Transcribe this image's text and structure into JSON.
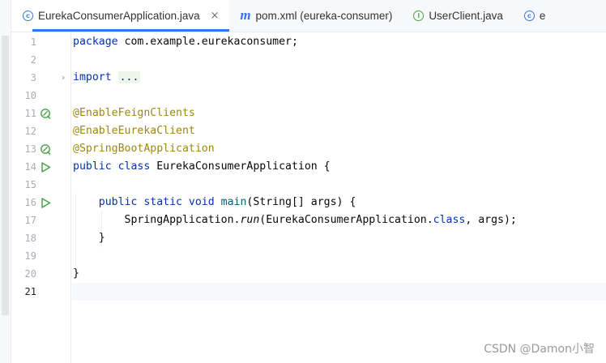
{
  "tabs": [
    {
      "label": "EurekaConsumerApplication.java",
      "icon": "class-icon",
      "glyph": "c",
      "active": true,
      "close": "×"
    },
    {
      "label": "pom.xml (eureka-consumer)",
      "icon": "maven-icon",
      "glyph": "m",
      "active": false
    },
    {
      "label": "UserClient.java",
      "icon": "interface-icon",
      "glyph": "I",
      "active": false
    },
    {
      "label": "e",
      "icon": "class-icon",
      "glyph": "c",
      "active": false
    }
  ],
  "gutter": {
    "line_numbers": [
      "1",
      "2",
      "3",
      "10",
      "11",
      "12",
      "13",
      "14",
      "15",
      "16",
      "17",
      "18",
      "19",
      "20",
      "21"
    ],
    "current_line": "21"
  },
  "code": {
    "line1": {
      "kw": "package",
      "rest": " com.example.eurekaconsumer;"
    },
    "line3": {
      "kw": "import",
      "folded": "..."
    },
    "line11": "@EnableFeignClients",
    "line12": "@EnableEurekaClient",
    "line13": "@SpringBootApplication",
    "line14": {
      "kw": "public class",
      "rest": " EurekaConsumerApplication {"
    },
    "line16": {
      "indent": "    ",
      "kw": "public static void",
      "method": "main",
      "rest": "(String[] args) {"
    },
    "line17": {
      "indent": "        ",
      "pre": "SpringApplication.",
      "call": "run",
      "mid": "(EurekaConsumerApplication.",
      "kw": "class",
      "post": ", args);"
    },
    "line18": "    }",
    "line20": "}"
  },
  "watermark": "CSDN @Damon小智",
  "colors": {
    "keyword": "#0033b3",
    "annotation": "#9e880d",
    "method": "#00627a",
    "current_line": "#f5f8fe",
    "tab_underline": "#3574f0",
    "run_icon": "#4aa14a"
  }
}
